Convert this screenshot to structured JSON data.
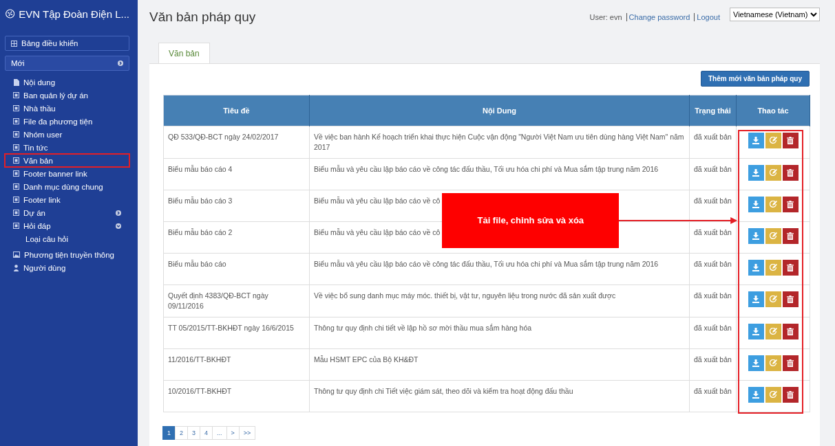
{
  "app_title": "EVN Tập Đoàn Điện L...",
  "sidebar": {
    "top_buttons": [
      {
        "label": "Bảng điều khiển",
        "kind": "dashboard"
      },
      {
        "label": "Mới",
        "kind": "menu"
      }
    ],
    "items": [
      {
        "label": "Nội dung",
        "kind": "doc",
        "selected": false
      },
      {
        "label": "Ban quản lý dự án",
        "kind": "square",
        "selected": false
      },
      {
        "label": "Nhà thầu",
        "kind": "square",
        "selected": false
      },
      {
        "label": "File đa phương tiện",
        "kind": "square",
        "selected": false
      },
      {
        "label": "Nhóm user",
        "kind": "square",
        "selected": false
      },
      {
        "label": "Tin tức",
        "kind": "square",
        "selected": false
      },
      {
        "label": "Văn bản",
        "kind": "square",
        "selected": true
      },
      {
        "label": "Footer banner link",
        "kind": "square",
        "selected": false
      },
      {
        "label": "Danh mục dùng chung",
        "kind": "square",
        "selected": false
      },
      {
        "label": "Footer link",
        "kind": "square",
        "selected": false
      },
      {
        "label": "Dự án",
        "kind": "square",
        "selected": false,
        "expanded": false
      },
      {
        "label": "Hỏi đáp",
        "kind": "square",
        "selected": false,
        "expanded": true,
        "children": [
          {
            "label": "Loại câu hỏi"
          }
        ]
      },
      {
        "label": "Phương tiện truyền thông",
        "kind": "image",
        "selected": false
      },
      {
        "label": "Người dùng",
        "kind": "person",
        "selected": false
      }
    ]
  },
  "page_title": "Văn bản pháp quy",
  "user_bar": {
    "user": "User: evn",
    "links": [
      "Change password",
      "Logout"
    ]
  },
  "language": {
    "value": "Vietnamese (Vietnam)"
  },
  "tabs": [
    {
      "label": "Văn bản",
      "selected": true
    }
  ],
  "add_button": "Thêm mới văn bản pháp quy",
  "table": {
    "columns": [
      "Tiêu đề",
      "Nội Dung",
      "Trạng thái",
      "Thao tác"
    ],
    "rows": [
      {
        "title": "QĐ 533/QĐ-BCT ngày 24/02/2017",
        "content": "Về việc ban hành Kế hoạch triển khai thực hiện Cuộc vận động \"Người Việt Nam ưu tiên dùng hàng Việt Nam\" năm 2017",
        "status": "đã xuất bản"
      },
      {
        "title": "Biểu mẫu báo cáo 4",
        "content": "Biểu mẫu và yêu cầu lập báo cáo về công tác đấu thầu, Tối ưu hóa chi phí và Mua sắm tập trung năm 2016",
        "status": "đã xuất bản"
      },
      {
        "title": "Biểu mẫu báo cáo 3",
        "content": "Biểu mẫu và yêu cầu lập báo cáo về cô",
        "status": "đã xuất bản"
      },
      {
        "title": "Biểu mẫu báo cáo 2",
        "content": "Biểu mẫu và yêu cầu lập báo cáo về cô",
        "status": "đã xuất bản"
      },
      {
        "title": "Biểu mẫu báo cáo",
        "content": "Biểu mẫu và yêu cầu lập báo cáo về công tác đấu thầu, Tối ưu hóa chi phí và Mua sắm tập trung năm 2016",
        "status": "đã xuất bản"
      },
      {
        "title": "Quyết định 4383/QĐ-BCT ngày 09/11/2016",
        "content": "Về việc bổ sung danh mục máy móc. thiết bị, vật tư, nguyên liệu trong nước đã sản xuất được",
        "status": "đã xuất bản"
      },
      {
        "title": "TT 05/2015/TT-BKHĐT ngày 16/6/2015",
        "content": "Thông tư quy định chi tiết về lập hồ sơ mời thầu mua sắm hàng hóa",
        "status": "đã xuất bản"
      },
      {
        "title": "11/2016/TT-BKHĐT",
        "content": "Mẫu HSMT EPC của Bộ KH&ĐT",
        "status": "đã xuất bản"
      },
      {
        "title": "10/2016/TT-BKHĐT",
        "content": "Thông tư quy định chi Tiết việc giám sát, theo dõi và kiểm tra hoạt động đấu thầu",
        "status": "đã xuất bản"
      }
    ],
    "actions": [
      {
        "kind": "download"
      },
      {
        "kind": "edit"
      },
      {
        "kind": "delete"
      }
    ]
  },
  "pagination": [
    {
      "label": "1",
      "selected": true
    },
    {
      "label": "2",
      "selected": false
    },
    {
      "label": "3",
      "selected": false
    },
    {
      "label": "4",
      "selected": false
    },
    {
      "label": "...",
      "selected": false
    },
    {
      "label": ">",
      "selected": false
    },
    {
      "label": ">>",
      "selected": false
    }
  ],
  "annotation": {
    "label": "Tải file, chỉnh sửa và xóa"
  }
}
